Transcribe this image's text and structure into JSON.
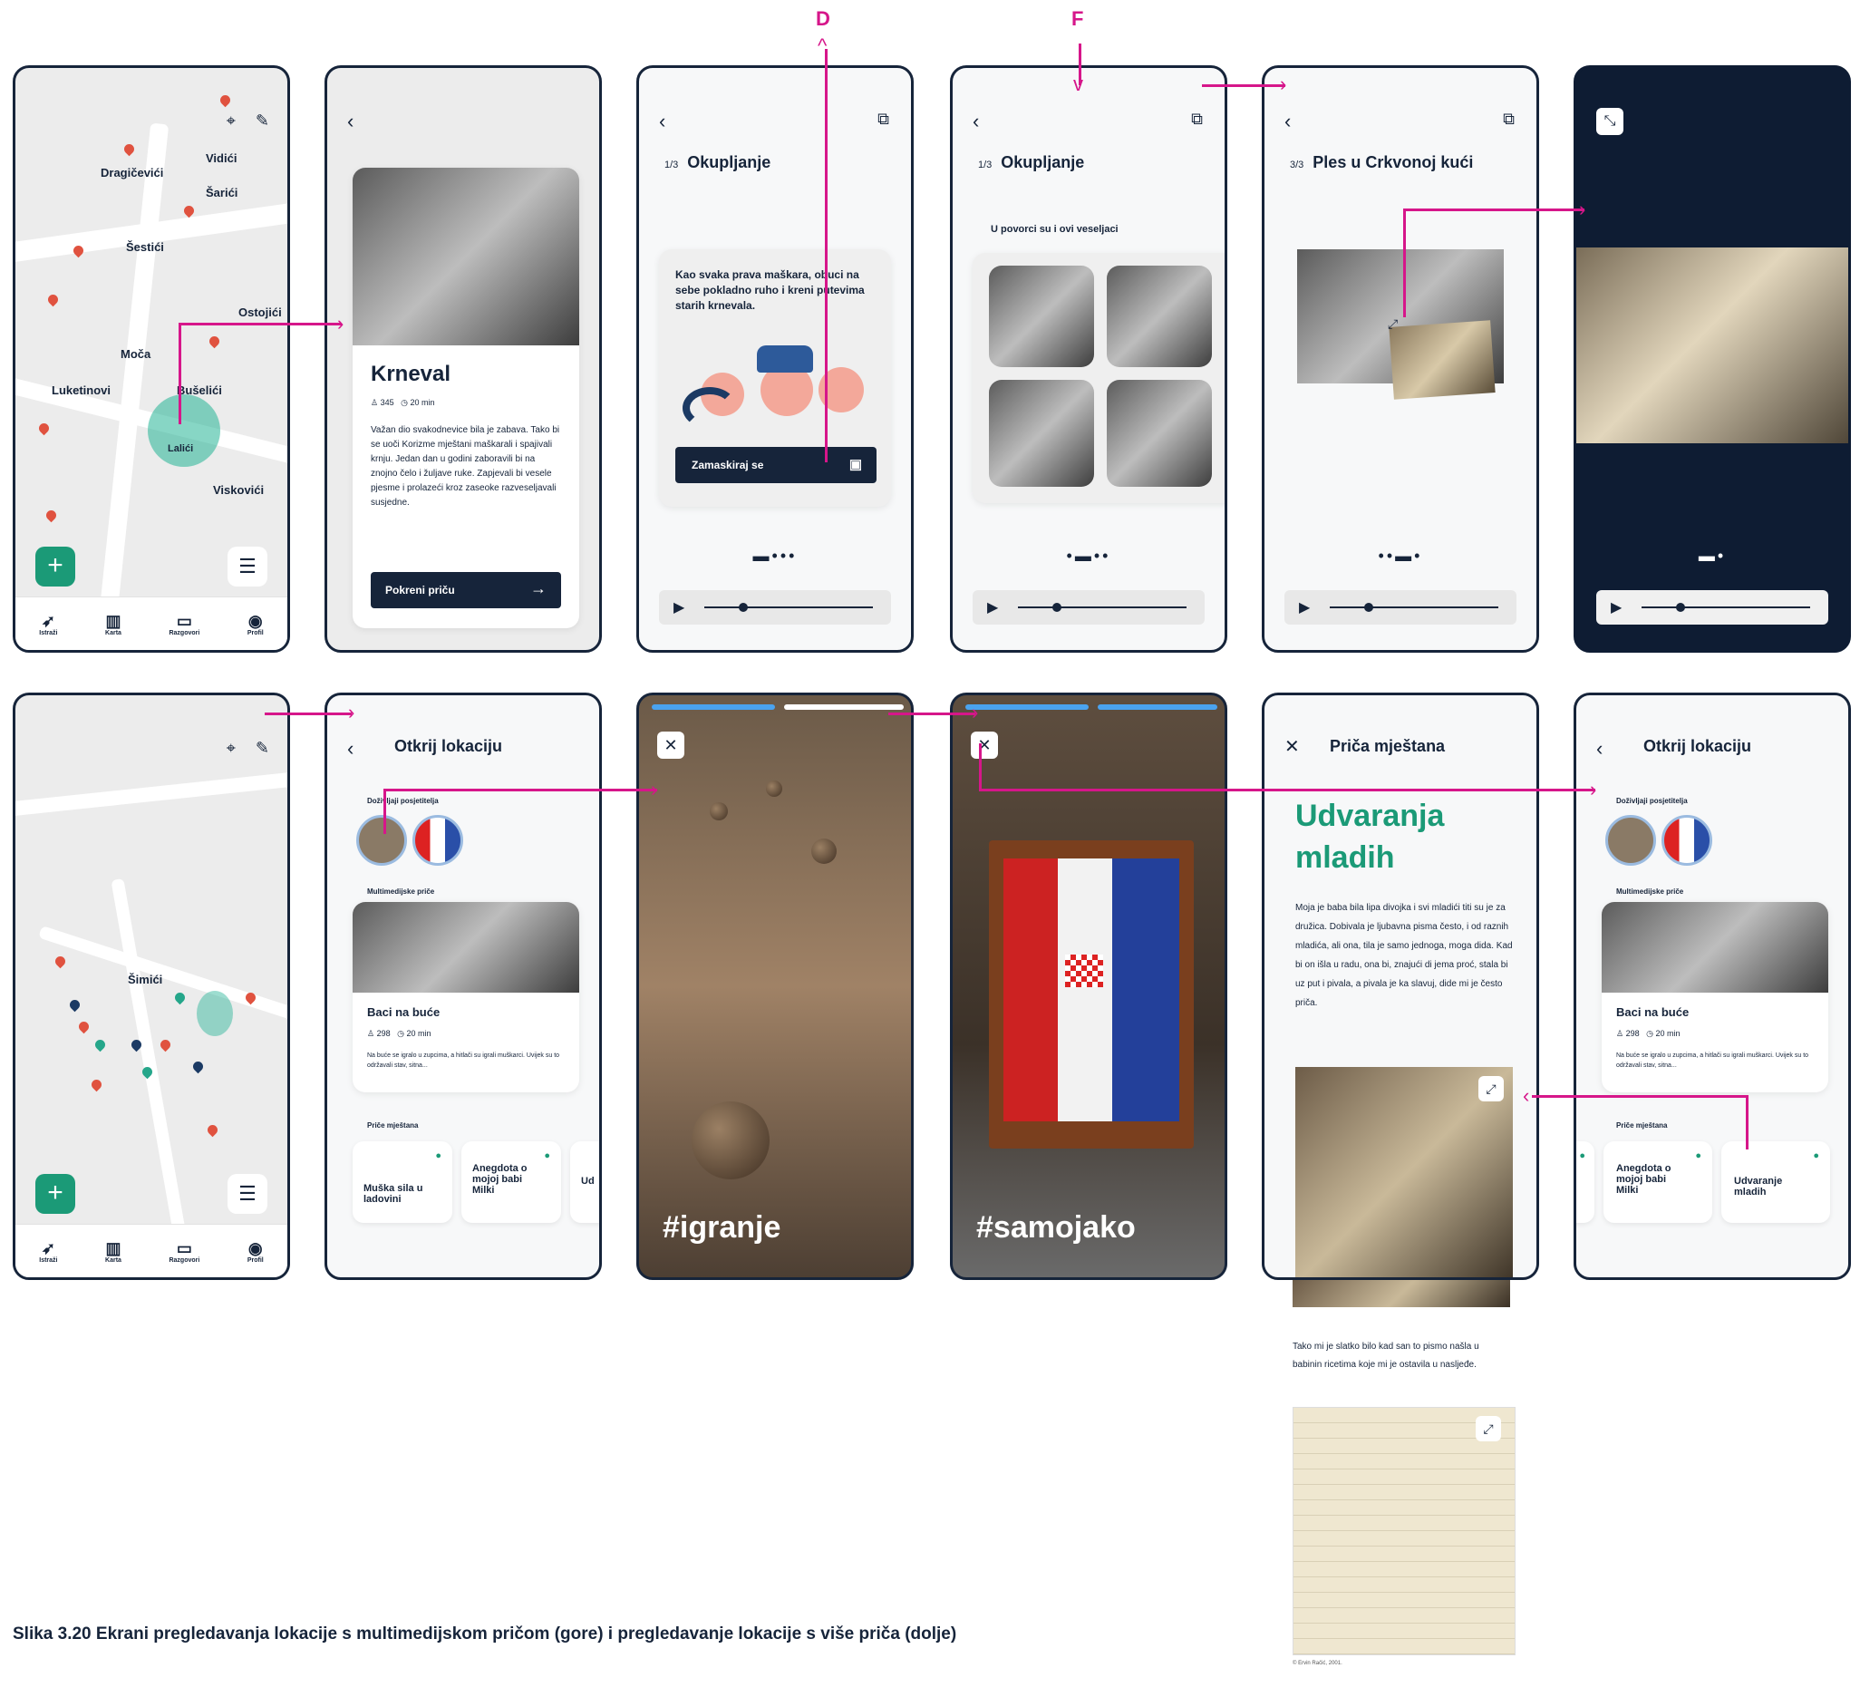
{
  "annotations": {
    "label_d": "D",
    "label_f": "F"
  },
  "caption": "Slika 3.20 Ekrani pregledavanja lokacije s multimedijskom pričom (gore) i pregledavanje lokacije s više priča (dolje)",
  "tabbar": {
    "items": [
      "Istraži",
      "Karta",
      "Razgovori",
      "Profil"
    ]
  },
  "map1": {
    "villages": [
      "Vidići",
      "Dragičevići",
      "Šarići",
      "Šestići",
      "Ostojići",
      "Moča",
      "Luketinovi",
      "Bušelići",
      "Lalići",
      "Viskovići"
    ]
  },
  "krneval": {
    "title": "Krneval",
    "stat_count": "345",
    "duration": "20 min",
    "text": "Važan dio svakodnevice bila je zabava. Tako bi se uoči Korizme mještani maškarali i spajivali krnju. Jedan dan u godini zaboravili bi na znojno čelo i žuljave ruke. Zapjevali bi vesele pjesme i prolazeći kroz zaseoke razveseljavali susjedne.",
    "cta": "Pokreni priču"
  },
  "okupljanje1": {
    "step": "1/3",
    "title": "Okupljanje",
    "card_text": "Kao svaka prava maškara, obuci na sebe pokladno ruho i kreni putevima starih krnevala.",
    "cta": "Zamaskiraj se"
  },
  "okupljanje2": {
    "step": "1/3",
    "title": "Okupljanje",
    "subtitle": "U povorci su i ovi veseljaci"
  },
  "ples": {
    "step": "3/3",
    "title": "Ples u Crkvonoj kući"
  },
  "otkrij": {
    "title": "Otkrij lokaciju",
    "section_a": "Doživljaji posjetitelja",
    "section_b": "Multimedijske priče",
    "story_title": "Baci na buće",
    "story_count": "298",
    "story_duration": "20 min",
    "story_text": "Na buće se igralo u zupcima, a hitlači su igrali muškarci. Uvijek su to održavali stav, sitna...",
    "section_c": "Priče mještana",
    "pills": [
      "Muška sila u ladovini",
      "Anegdota o mojoj babi Milki",
      "Ud"
    ]
  },
  "map2": {
    "village": "Šimići"
  },
  "story_tags": {
    "a": "#igranje",
    "b": "#samojako"
  },
  "prica": {
    "title": "Priča mještana",
    "heading": "Udvaranja mladih",
    "text1": "Moja je baba bila lipa divojka i svi mladići titi su je za družica. Dobivala je ljubavna pisma često, i od raznih mladića, ali ona, tila je samo jednoga, moga dida. Kad bi on išla u radu, ona bi, znajući di jema proć, stala bi uz put i pivala, a pivala je ka slavuj, dide mi je često priča.",
    "text2": "Tako mi je slatko bilo kad san to pismo našla u babinin ricetima koje mi je ostavila u nasljeđe.",
    "credit": "© Ervin Račić, 2001."
  },
  "otkrij2": {
    "title": "Otkrij lokaciju",
    "section_a": "Doživljaji posjetitelja",
    "section_b": "Multimedijske priče",
    "story_title": "Baci na buće",
    "story_count": "298",
    "story_duration": "20 min",
    "story_text": "Na buće se igralo u zupcima, a hitlači su igrali muškarci. Uvijek su to održavali stav, sitna...",
    "section_c": "Priče mještana",
    "pills": [
      "Anegdota o mojoj babi Milki",
      "Udvaranje mladih"
    ]
  },
  "colors": {
    "accent": "#d6168a",
    "primary": "#16243a",
    "teal": "#1b9a77"
  }
}
